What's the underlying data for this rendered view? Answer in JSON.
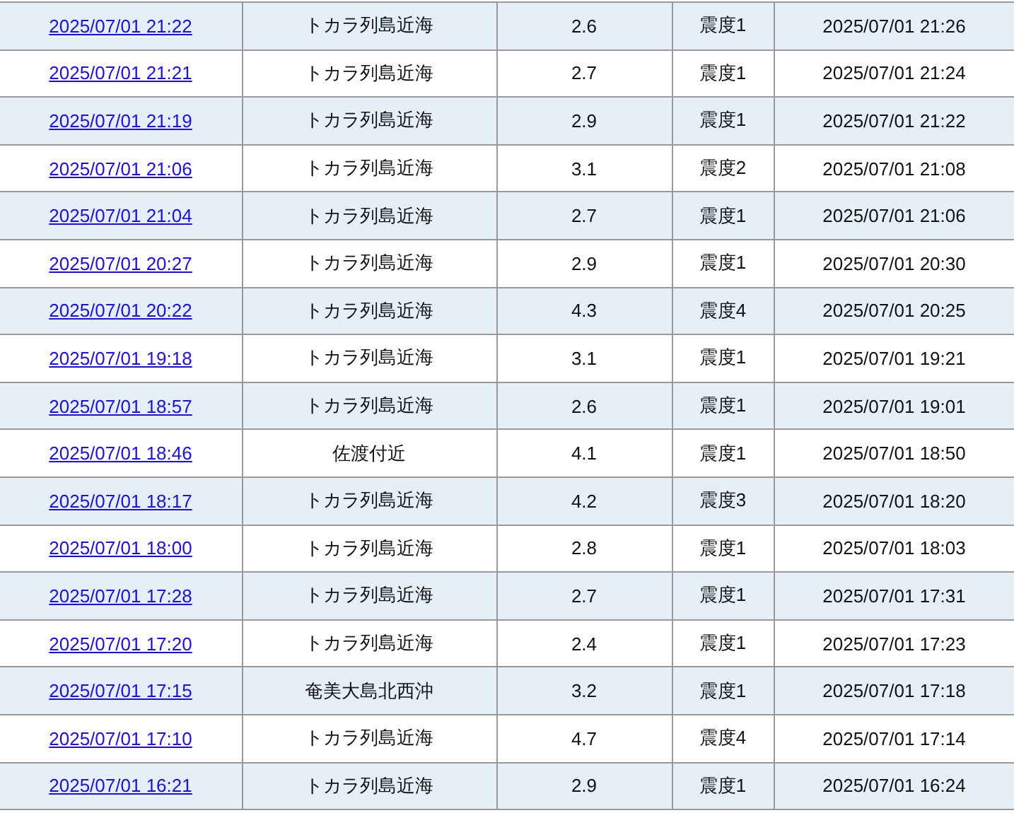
{
  "table": {
    "rows": [
      {
        "time": "2025/07/01 21:22",
        "region": "トカラ列島近海",
        "magnitude": "2.6",
        "intensity": "震度1",
        "announced": "2025/07/01 21:26"
      },
      {
        "time": "2025/07/01 21:21",
        "region": "トカラ列島近海",
        "magnitude": "2.7",
        "intensity": "震度1",
        "announced": "2025/07/01 21:24"
      },
      {
        "time": "2025/07/01 21:19",
        "region": "トカラ列島近海",
        "magnitude": "2.9",
        "intensity": "震度1",
        "announced": "2025/07/01 21:22"
      },
      {
        "time": "2025/07/01 21:06",
        "region": "トカラ列島近海",
        "magnitude": "3.1",
        "intensity": "震度2",
        "announced": "2025/07/01 21:08"
      },
      {
        "time": "2025/07/01 21:04",
        "region": "トカラ列島近海",
        "magnitude": "2.7",
        "intensity": "震度1",
        "announced": "2025/07/01 21:06"
      },
      {
        "time": "2025/07/01 20:27",
        "region": "トカラ列島近海",
        "magnitude": "2.9",
        "intensity": "震度1",
        "announced": "2025/07/01 20:30"
      },
      {
        "time": "2025/07/01 20:22",
        "region": "トカラ列島近海",
        "magnitude": "4.3",
        "intensity": "震度4",
        "announced": "2025/07/01 20:25"
      },
      {
        "time": "2025/07/01 19:18",
        "region": "トカラ列島近海",
        "magnitude": "3.1",
        "intensity": "震度1",
        "announced": "2025/07/01 19:21"
      },
      {
        "time": "2025/07/01 18:57",
        "region": "トカラ列島近海",
        "magnitude": "2.6",
        "intensity": "震度1",
        "announced": "2025/07/01 19:01"
      },
      {
        "time": "2025/07/01 18:46",
        "region": "佐渡付近",
        "magnitude": "4.1",
        "intensity": "震度1",
        "announced": "2025/07/01 18:50"
      },
      {
        "time": "2025/07/01 18:17",
        "region": "トカラ列島近海",
        "magnitude": "4.2",
        "intensity": "震度3",
        "announced": "2025/07/01 18:20"
      },
      {
        "time": "2025/07/01 18:00",
        "region": "トカラ列島近海",
        "magnitude": "2.8",
        "intensity": "震度1",
        "announced": "2025/07/01 18:03"
      },
      {
        "time": "2025/07/01 17:28",
        "region": "トカラ列島近海",
        "magnitude": "2.7",
        "intensity": "震度1",
        "announced": "2025/07/01 17:31"
      },
      {
        "time": "2025/07/01 17:20",
        "region": "トカラ列島近海",
        "magnitude": "2.4",
        "intensity": "震度1",
        "announced": "2025/07/01 17:23"
      },
      {
        "time": "2025/07/01 17:15",
        "region": "奄美大島北西沖",
        "magnitude": "3.2",
        "intensity": "震度1",
        "announced": "2025/07/01 17:18"
      },
      {
        "time": "2025/07/01 17:10",
        "region": "トカラ列島近海",
        "magnitude": "4.7",
        "intensity": "震度4",
        "announced": "2025/07/01 17:14"
      },
      {
        "time": "2025/07/01 16:21",
        "region": "トカラ列島近海",
        "magnitude": "2.9",
        "intensity": "震度1",
        "announced": "2025/07/01 16:24"
      }
    ]
  }
}
